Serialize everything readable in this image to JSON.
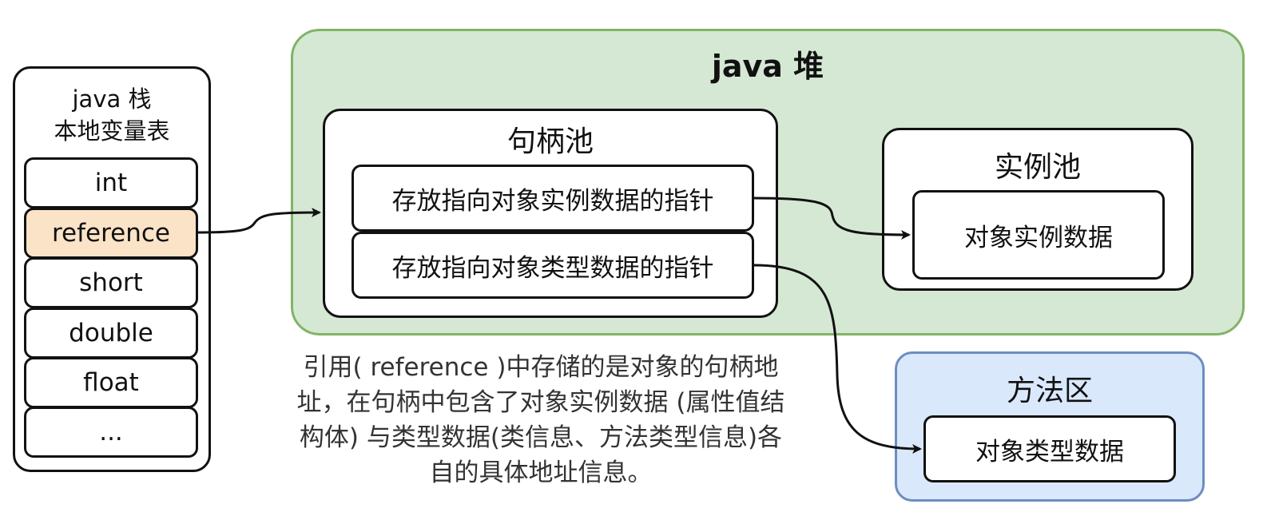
{
  "stack": {
    "title_line1": "java 栈",
    "title_line2": "本地变量表",
    "slots": [
      "int",
      "reference",
      "short",
      "double",
      "float",
      "..."
    ]
  },
  "heap": {
    "title": "java 堆",
    "handle_pool": {
      "title": "句柄池",
      "instance_pointer": "存放指向对象实例数据的指针",
      "type_pointer": "存放指向对象类型数据的指针"
    },
    "instance_pool": {
      "title": "实例池",
      "instance_data": "对象实例数据"
    }
  },
  "method_area": {
    "title": "方法区",
    "type_data": "对象类型数据"
  },
  "caption": {
    "line1": "引用( reference )中存储的是对象的句柄地",
    "line2": "址，在句柄中包含了对象实例数据 (属性值结",
    "line3": "构体) 与类型数据(类信息、方法类型信息)各",
    "line4": "自的具体地址信息。"
  },
  "colors": {
    "heap_fill": "#d5e8d4",
    "heap_border": "#82b366",
    "method_area_fill": "#dae8fc",
    "method_area_border": "#6c8ebf",
    "reference_fill": "#fbe3c8"
  }
}
